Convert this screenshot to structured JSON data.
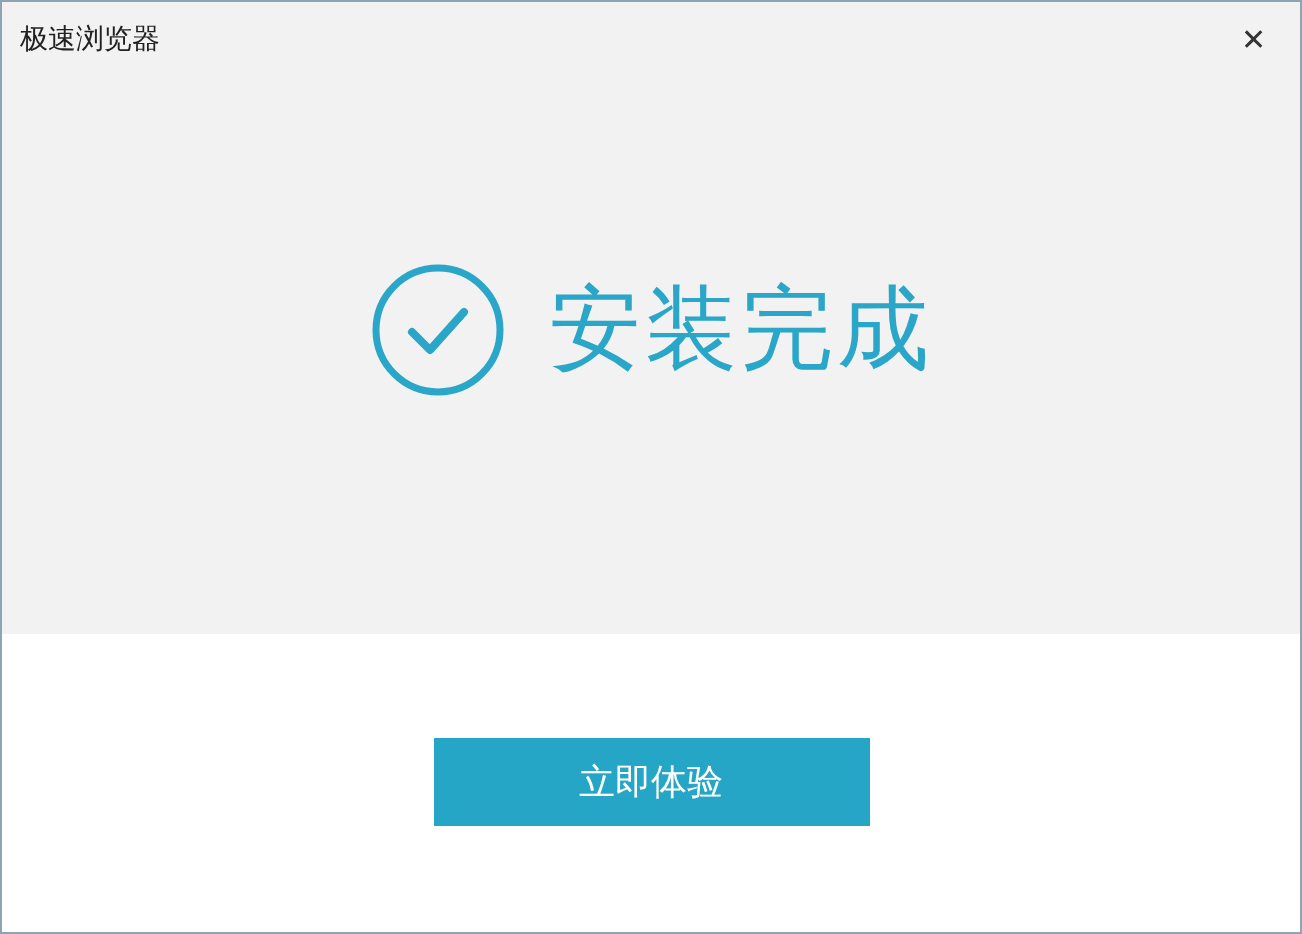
{
  "window": {
    "title": "极速浏览器",
    "close": "✕"
  },
  "status": {
    "kind": "done",
    "message": "安装完成"
  },
  "buttons": [
    "立即体验"
  ]
}
